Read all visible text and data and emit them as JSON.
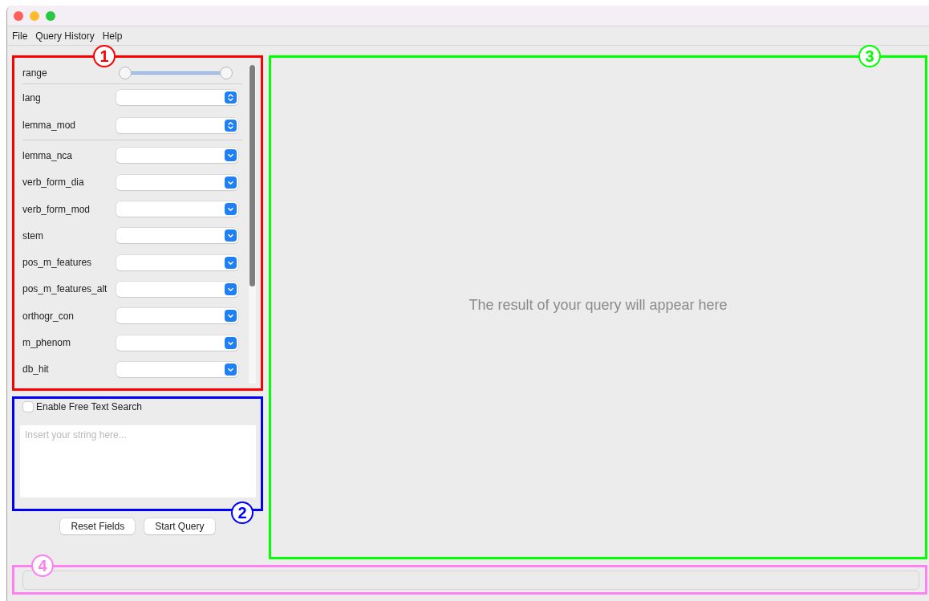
{
  "menu": [
    "File",
    "Query History",
    "Help"
  ],
  "filters": {
    "annotation": {
      "label": "1",
      "color": "#ff0000"
    },
    "fields": [
      {
        "kind": "slider",
        "label": "range",
        "handles": [
          {
            "level": 0
          },
          {
            "level": 1
          }
        ]
      },
      {
        "kind": "stepper",
        "label": "lang"
      },
      {
        "kind": "stepper",
        "label": "lemma_mod"
      },
      {
        "kind": "dropdown",
        "label": "lemma_nca"
      },
      {
        "kind": "dropdown",
        "label": "verb_form_dia"
      },
      {
        "kind": "dropdown",
        "label": "verb_form_mod"
      },
      {
        "kind": "dropdown",
        "label": "stem"
      },
      {
        "kind": "dropdown",
        "label": "pos_m_features"
      },
      {
        "kind": "dropdown",
        "label": "pos_m_features_alt"
      },
      {
        "kind": "dropdown",
        "label": "orthogr_con"
      },
      {
        "kind": "dropdown",
        "label": "m_phenom"
      },
      {
        "kind": "dropdown",
        "label": "db_hit"
      }
    ]
  },
  "free_text": {
    "annotation": {
      "label": "2",
      "color": "#0000ff"
    },
    "checkbox": {
      "label": "Enable Free Text Search",
      "checked": false
    },
    "placeholder": "Insert your string here..."
  },
  "buttons": [
    "Reset Fields",
    "Start Query"
  ],
  "results": {
    "annotation": {
      "label": "3",
      "color": "#00ff00"
    },
    "message": "The result of your query will appear here"
  },
  "status": {
    "annotation": {
      "label": "4",
      "color": "#ff80f0"
    }
  }
}
